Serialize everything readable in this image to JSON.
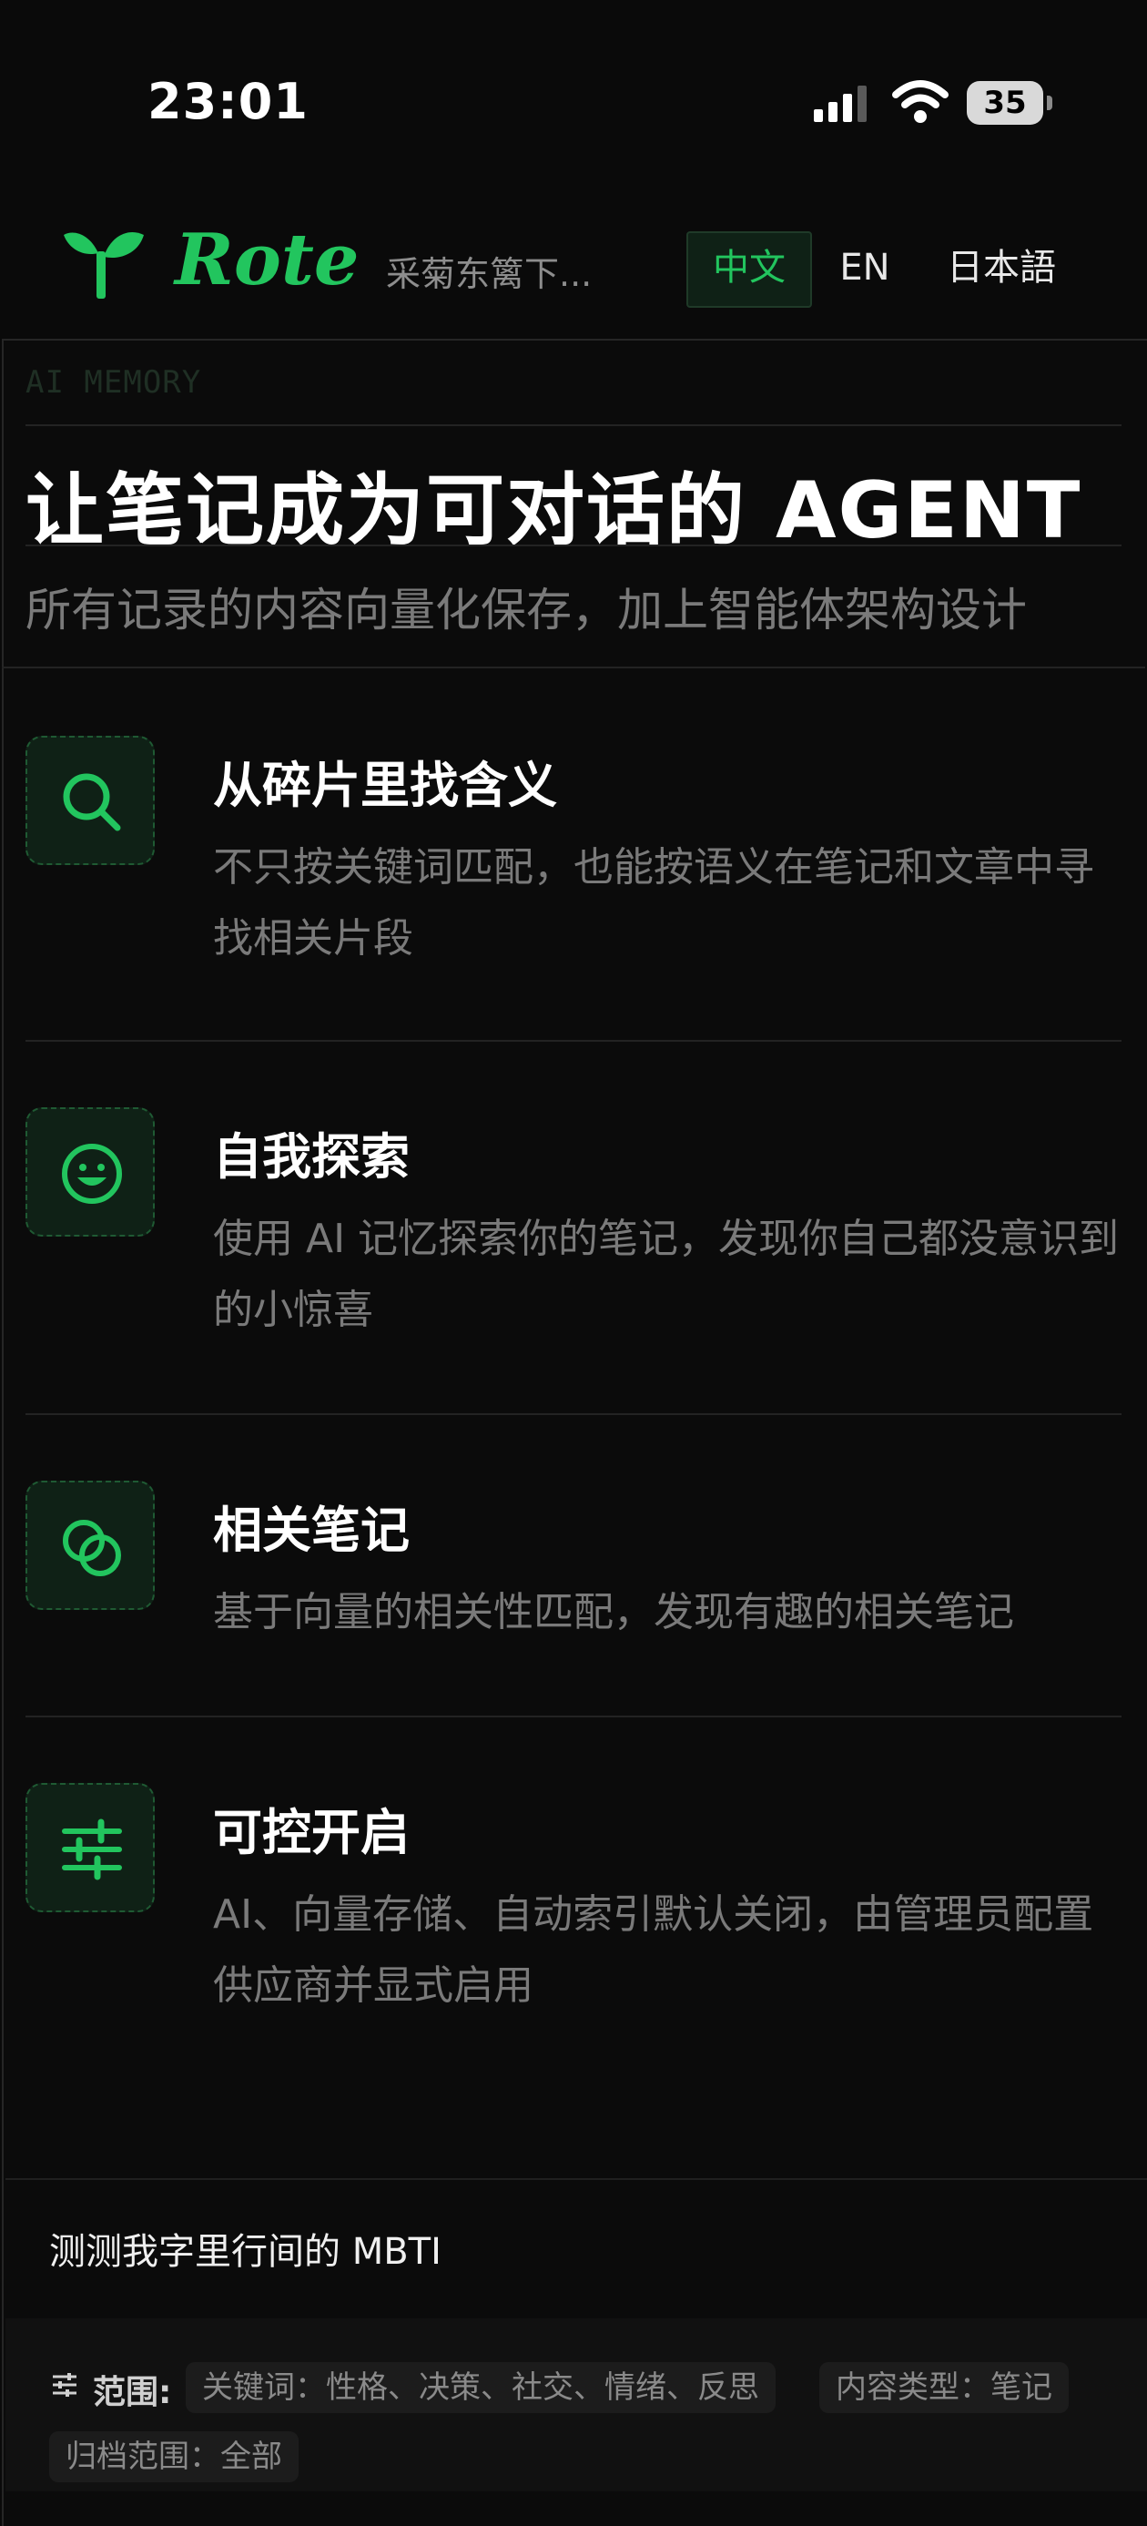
{
  "status_bar": {
    "time": "23:01",
    "battery_level": "35"
  },
  "nav": {
    "brand": "Rote",
    "tagline": "采菊东篱下...",
    "languages": [
      "中文",
      "EN",
      "日本語"
    ],
    "active_language": "中文"
  },
  "hero": {
    "kicker": "AI MEMORY",
    "title": "让笔记成为可对话的 AGENT",
    "subtitle": "所有记录的内容向量化保存，加上智能体架构设计"
  },
  "features": [
    {
      "icon": "search-icon",
      "title": "从碎片里找含义",
      "desc": "不只按关键词匹配，也能按语义在笔记和文章中寻找相关片段"
    },
    {
      "icon": "smile-icon",
      "title": "自我探索",
      "desc": "使用 AI 记忆探索你的笔记，发现你自己都没意识到的小惊喜"
    },
    {
      "icon": "linked-circles-icon",
      "title": "相关笔记",
      "desc": "基于向量的相关性匹配，发现有趣的相关笔记"
    },
    {
      "icon": "sliders-icon",
      "title": "可控开启",
      "desc": "AI、向量存储、自动索引默认关闭，由管理员配置供应商并显式启用"
    }
  ],
  "mbti": {
    "title": "测测我字里行间的 MBTI",
    "scope_label": "范围:",
    "chips": [
      "关键词：性格、决策、社交、情绪、反思",
      "内容类型：笔记",
      "归档范围：全部"
    ]
  },
  "colors": {
    "accent": "#22c55e",
    "background": "#0a0a0a",
    "muted_text": "#7a7a7a"
  }
}
